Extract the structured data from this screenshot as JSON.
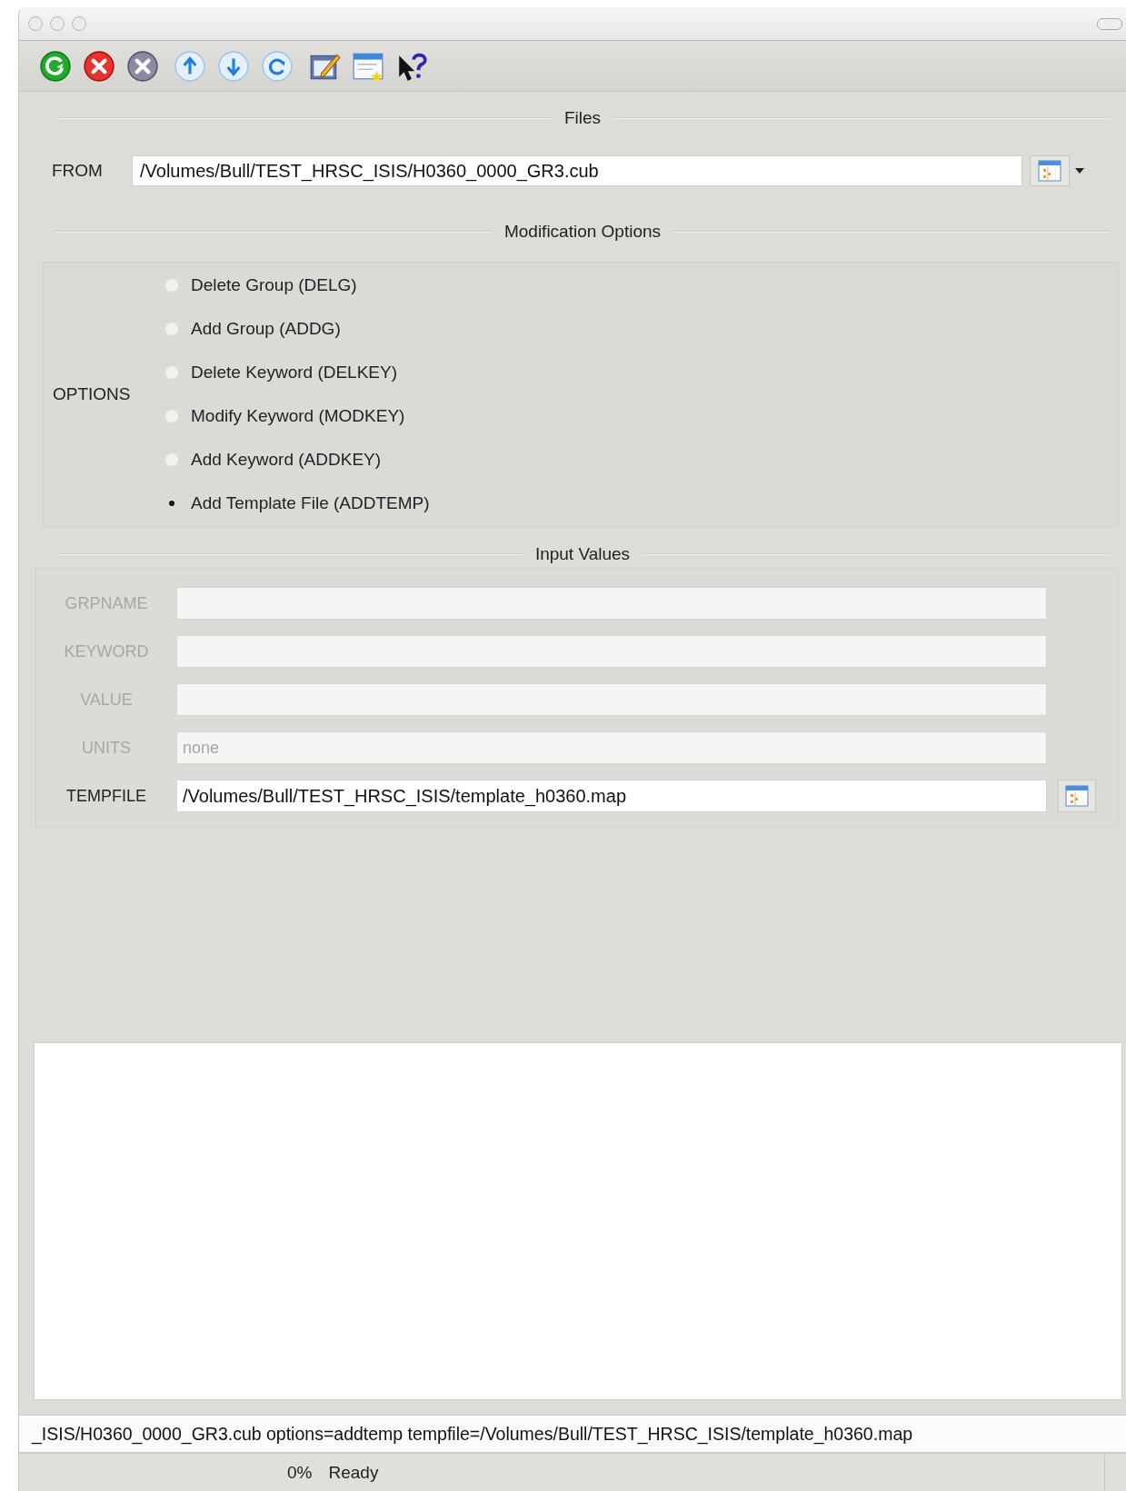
{
  "files": {
    "title": "Files",
    "from": {
      "label": "FROM",
      "value": "/Volumes/Bull/TEST_HRSC_ISIS/H0360_0000_GR3.cub",
      "browse": true,
      "dropdown": true
    }
  },
  "modification_options": {
    "title": "Modification Options",
    "label": "OPTIONS",
    "options": [
      {
        "label": "Delete Group (DELG)",
        "selected": false
      },
      {
        "label": "Add Group (ADDG)",
        "selected": false
      },
      {
        "label": "Delete Keyword (DELKEY)",
        "selected": false
      },
      {
        "label": "Modify Keyword (MODKEY)",
        "selected": false
      },
      {
        "label": "Add Keyword (ADDKEY)",
        "selected": false
      },
      {
        "label": "Add Template File (ADDTEMP)",
        "selected": true
      }
    ]
  },
  "input_values": {
    "title": "Input Values",
    "fields": [
      {
        "label": "GRPNAME",
        "disabled": true,
        "browse": false
      },
      {
        "label": "KEYWORD",
        "disabled": true,
        "browse": false
      },
      {
        "label": "VALUE",
        "disabled": true,
        "browse": false
      },
      {
        "label": "UNITS",
        "placeholder": "none",
        "disabled": true,
        "browse": false
      },
      {
        "label": "TEMPFILE",
        "value": "/Volumes/Bull/TEST_HRSC_ISIS/template_h0360.map",
        "disabled": false,
        "browse": true
      }
    ]
  },
  "command_line": "_ISIS/H0360_0000_GR3.cub options=addtemp tempfile=/Volumes/Bull/TEST_HRSC_ISIS/template_h0360.map",
  "status_bar": {
    "progress": "0%",
    "message": "Ready"
  }
}
